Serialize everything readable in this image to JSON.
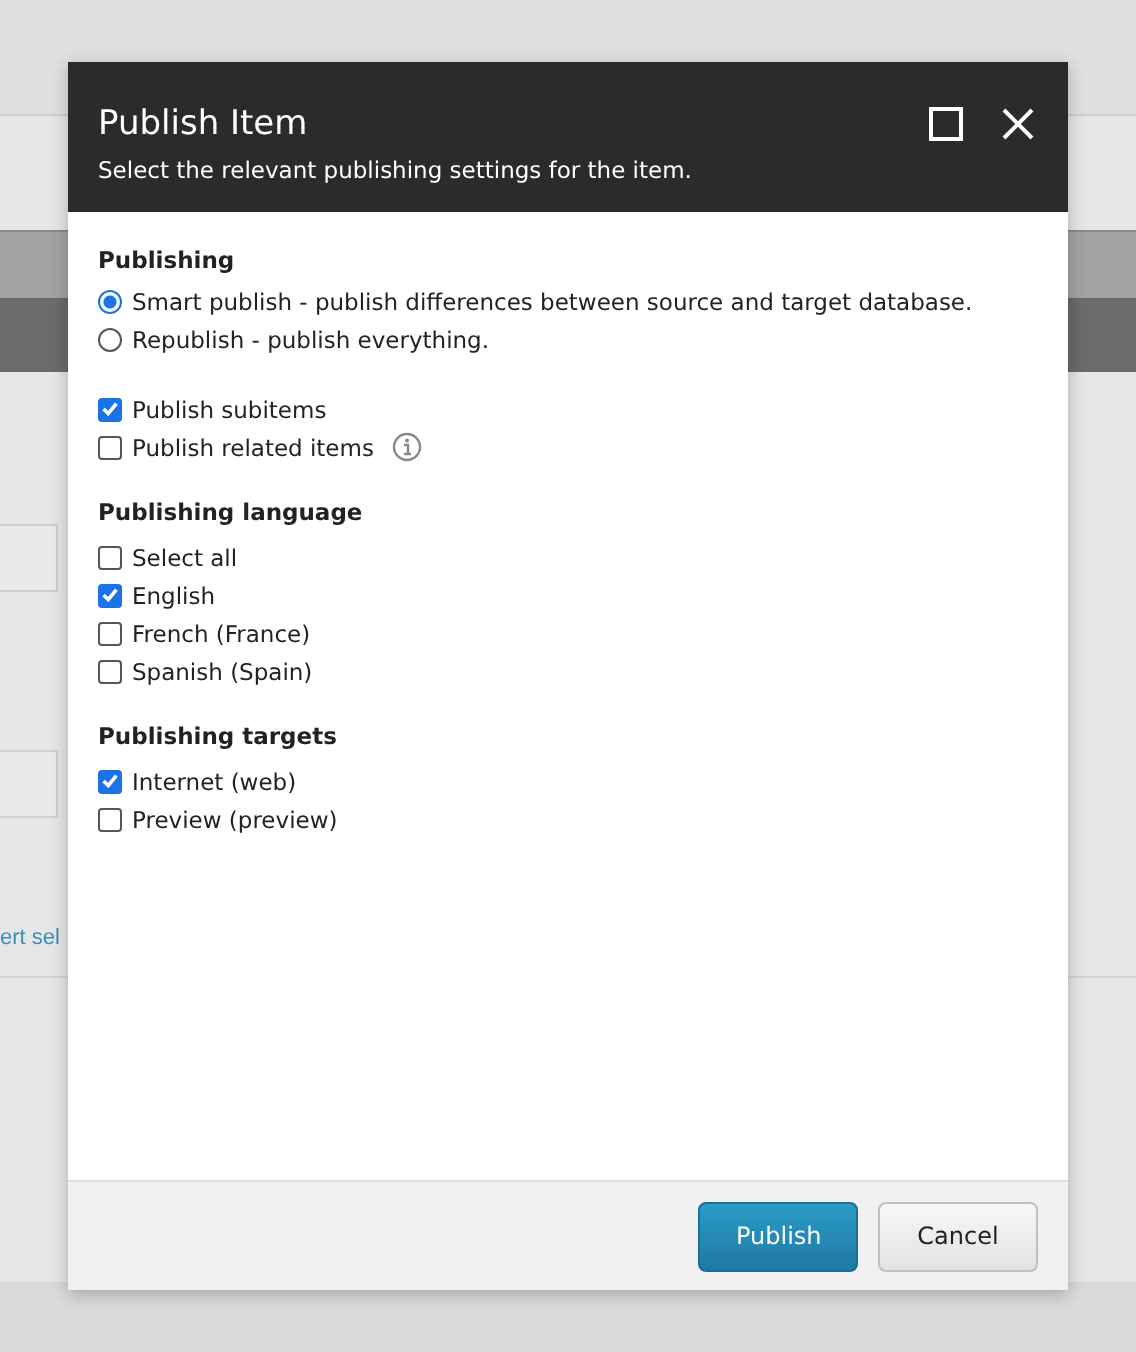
{
  "background": {
    "link": "ert sel"
  },
  "dialog": {
    "title": "Publish Item",
    "subtitle": "Select the relevant publishing settings for the item.",
    "sections": [
      {
        "heading": "Publishing",
        "items": [
          {
            "kind": "radio",
            "label": "Smart publish - publish differences between source and target database.",
            "selected": true
          },
          {
            "kind": "radio",
            "label": "Republish - publish everything.",
            "selected": false
          }
        ]
      },
      {
        "items": [
          {
            "kind": "checkbox",
            "label": "Publish subitems",
            "checked": true
          },
          {
            "kind": "checkbox",
            "label": "Publish related items",
            "checked": false,
            "info": true
          }
        ]
      },
      {
        "heading": "Publishing language",
        "items": [
          {
            "kind": "checkbox",
            "label": "Select all",
            "checked": false
          },
          {
            "kind": "checkbox",
            "label": "English",
            "checked": true
          },
          {
            "kind": "checkbox",
            "label": "French (France)",
            "checked": false
          },
          {
            "kind": "checkbox",
            "label": "Spanish (Spain)",
            "checked": false
          }
        ]
      },
      {
        "heading": "Publishing targets",
        "items": [
          {
            "kind": "checkbox",
            "label": "Internet (web)",
            "checked": true
          },
          {
            "kind": "checkbox",
            "label": "Preview (preview)",
            "checked": false
          }
        ]
      }
    ],
    "buttons": [
      {
        "label": "Publish",
        "kind": "primary"
      },
      {
        "label": "Cancel",
        "kind": "secondary"
      }
    ]
  }
}
